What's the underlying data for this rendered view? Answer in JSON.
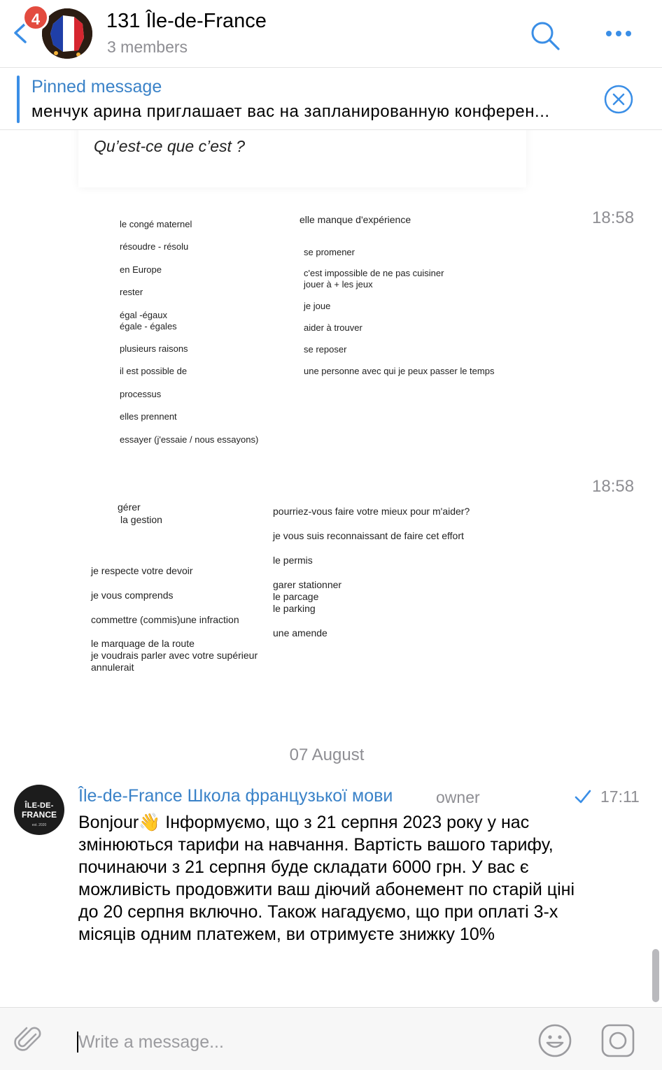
{
  "header": {
    "title": "131 Île-de-France",
    "subtitle": "3 members",
    "badge": "4"
  },
  "pinned": {
    "title": "Pinned message",
    "text": "менчук арина приглашает вас на запланированную конферен..."
  },
  "image1": {
    "question": "Qu’est-ce que c’est ?"
  },
  "image2": {
    "time": "18:58",
    "left_items": [
      "le congé maternel",
      "résoudre - résolu",
      "en Europe",
      "rester",
      "égal -égaux",
      "égale - égales",
      "plusieurs raisons",
      "il est possible de",
      "processus",
      "elles prennent",
      "essayer (j'essaie / nous essayons)"
    ],
    "right_items": [
      "elle manque d'expérience",
      "se promener",
      "c'est impossible de ne pas cuisiner",
      "jouer à + les jeux",
      "je joue",
      "aider à trouver",
      "se reposer",
      "une personne avec qui je peux passer le temps"
    ]
  },
  "image3": {
    "time": "18:58",
    "left_items": [
      "gérer",
      "la gestion",
      "je respecte votre devoir",
      "je vous comprends",
      "commettre (commis)une infraction",
      "le marquage de la route",
      "je voudrais parler avec votre supérieur",
      "annulerait"
    ],
    "right_items": [
      "pourriez-vous faire votre mieux pour m'aider?",
      "je vous suis reconnaissant de faire cet effort",
      "le permis",
      "garer stationner",
      "le parcage",
      "le parking",
      "une amende"
    ]
  },
  "date_separator": "07 August",
  "message": {
    "avatar": {
      "line1": "ÎLE-DE-",
      "line2": "FRANCE",
      "line3": "est. 2020"
    },
    "sender": "Île-de-France Школа французької мови",
    "role": "owner",
    "time": "17:11",
    "text": "Bonjour👋  Інформуємо, що з 21 серпня 2023 року у нас змінюються тарифи на навчання. Вартість вашого тарифу, починаючи з 21 серпня буде складати 6000 грн. У вас є можливість продовжити ваш діючий абонемент по старій ціні до 20 серпня включно. Також нагадуємо, що при оплаті 3-х місяців одним платежем, ви отримуєте знижку 10%"
  },
  "composer": {
    "placeholder": "Write a message..."
  },
  "colors": {
    "accent": "#3a82c8",
    "badge": "#e34b3f",
    "muted": "#8e8e93"
  },
  "icons": [
    "back-icon",
    "search-icon",
    "more-icon",
    "close-circle-icon",
    "check-icon",
    "attach-icon",
    "emoji-icon",
    "camera-icon"
  ]
}
